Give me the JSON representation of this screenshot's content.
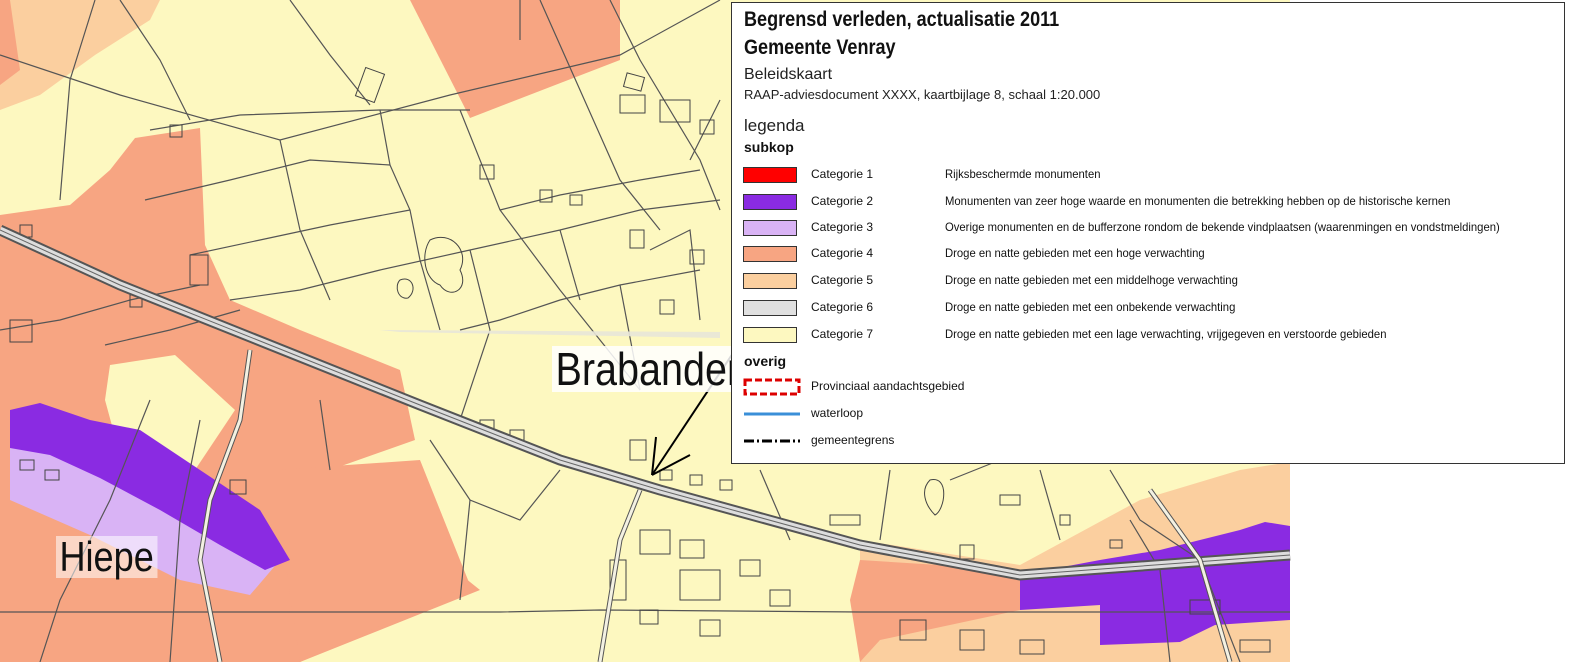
{
  "map": {
    "place_labels": {
      "brabander": "Brabander",
      "hiepe": "Hiepe"
    }
  },
  "legend": {
    "title_line1": "Begrensd verleden, actualisatie 2011",
    "title_line2": "Gemeente Venray",
    "subtitle": "Beleidskaart",
    "document": "RAAP-adviesdocument XXXX, kaartbijlage 8, schaal 1:20.000",
    "legend_heading": "legenda",
    "section_subkop": "subkop",
    "categories": [
      {
        "label": "Categorie 1",
        "description": "Rijksbeschermde monumenten",
        "color": "#ff0000"
      },
      {
        "label": "Categorie 2",
        "description": "Monumenten van zeer hoge waarde en monumenten die betrekking hebben op de historische kernen",
        "color": "#8a2be2"
      },
      {
        "label": "Categorie 3",
        "description": "Overige monumenten en de bufferzone rondom de bekende vindplaatsen (waarenmingen en vondstmeldingen)",
        "color": "#d9b3f5"
      },
      {
        "label": "Categorie 4",
        "description": "Droge en natte gebieden met een hoge verwachting",
        "color": "#f7a582"
      },
      {
        "label": "Categorie 5",
        "description": "Droge en natte gebieden met een middelhoge verwachting",
        "color": "#fbcf9f"
      },
      {
        "label": "Categorie 6",
        "description": "Droge en natte gebieden met een onbekende verwachting",
        "color": "#e0e0e0"
      },
      {
        "label": "Categorie 7",
        "description": "Droge en natte gebieden met een lage verwachting, vrijgegeven en verstoorde gebieden",
        "color": "#fdf8c0"
      }
    ],
    "section_overig": "overig",
    "other_items": [
      {
        "label": "Provinciaal aandachtsgebied",
        "symbol": "red-dashed-outline",
        "color": "#dd0000"
      },
      {
        "label": "waterloop",
        "symbol": "blue-line",
        "color": "#3a8fd8"
      },
      {
        "label": "gemeentegrens",
        "symbol": "dash-dot-line",
        "color": "#000000"
      }
    ]
  }
}
